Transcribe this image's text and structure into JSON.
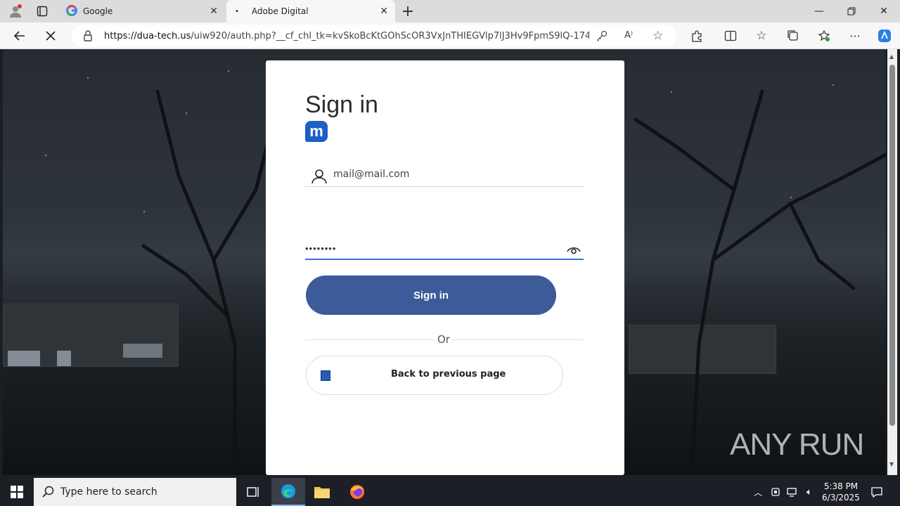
{
  "browser": {
    "tabs": [
      {
        "title": "Google",
        "active": false
      },
      {
        "title": "Adobe Digital",
        "active": true
      }
    ],
    "url_host": "https://dua-tech.us",
    "url_path": "/uiw920/auth.php?__cf_chl_tk=kvSkoBcKtGOhScOR3VxJnTHIEGVlp7lJ3Hv9FpmS9lQ-17428..."
  },
  "signin": {
    "heading": "Sign in",
    "logo_letter": "m",
    "email_value": "mail@mail.com",
    "password_value": "••••••••",
    "submit_label": "Sign in",
    "divider_text": "Or",
    "back_label": "Back to previous page"
  },
  "watermark": "ANY RUN",
  "taskbar": {
    "search_placeholder": "Type here to search",
    "time": "5:38 PM",
    "date": "6/3/2025"
  },
  "colors": {
    "primary_button": "#3d5a99",
    "logo": "#1c5fc6",
    "focus_underline": "#3b6ee8"
  }
}
